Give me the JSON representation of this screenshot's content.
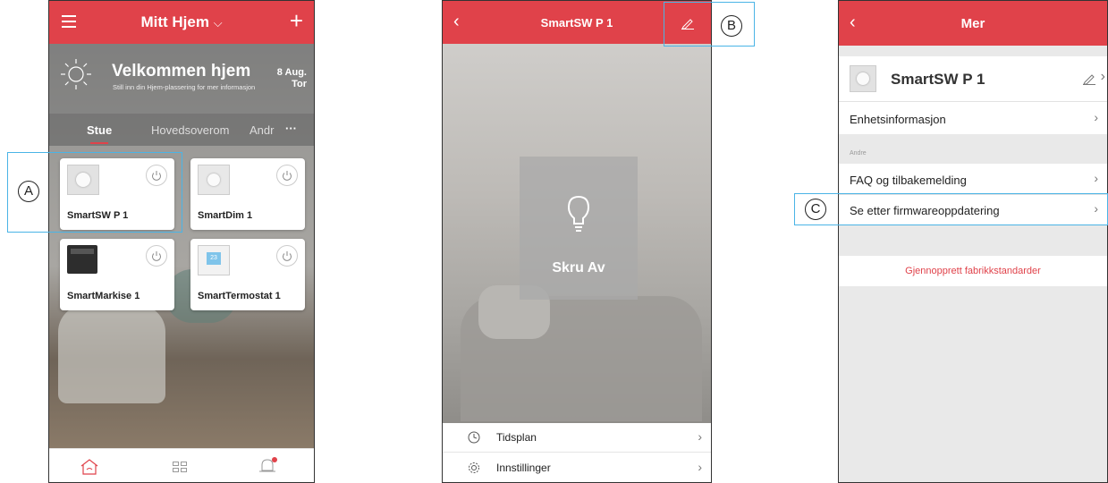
{
  "phone1": {
    "header": {
      "title": "Mitt Hjem",
      "title_chevron": "⌵"
    },
    "welcome": {
      "heading": "Velkommen hjem",
      "subtitle": "Still inn din Hjem-plassering for mer informasjon",
      "date": "8 Aug.",
      "day": "Tor"
    },
    "tabs": [
      {
        "label": "Stue"
      },
      {
        "label": "Hovedsoverom"
      },
      {
        "label": "Andr"
      }
    ],
    "more_tabs": "···",
    "devices": [
      {
        "name": "SmartSW P 1"
      },
      {
        "name": "SmartDim 1"
      },
      {
        "name": "SmartMarkise 1"
      },
      {
        "name": "SmartTermostat 1"
      }
    ],
    "thermostat_display": "23",
    "callout_label": "A"
  },
  "phone2": {
    "header": {
      "title": "SmartSW P 1"
    },
    "switch_label": "Skru Av",
    "menu": [
      {
        "label": "Tidsplan"
      },
      {
        "label": "Innstillinger"
      }
    ],
    "callout_label": "B"
  },
  "phone3": {
    "header": {
      "title": "Mer"
    },
    "device_name": "SmartSW P 1",
    "rows": {
      "device_info": "Enhetsinformasjon",
      "section_other": "Andre",
      "faq": "FAQ og tilbakemelding",
      "firmware": "Se etter firmwareoppdatering",
      "factory_reset": "Gjennopprett fabrikkstandarder"
    },
    "callout_label": "C"
  },
  "colors": {
    "brand_red": "#e0424a",
    "callout_blue": "#4ab4e6"
  }
}
